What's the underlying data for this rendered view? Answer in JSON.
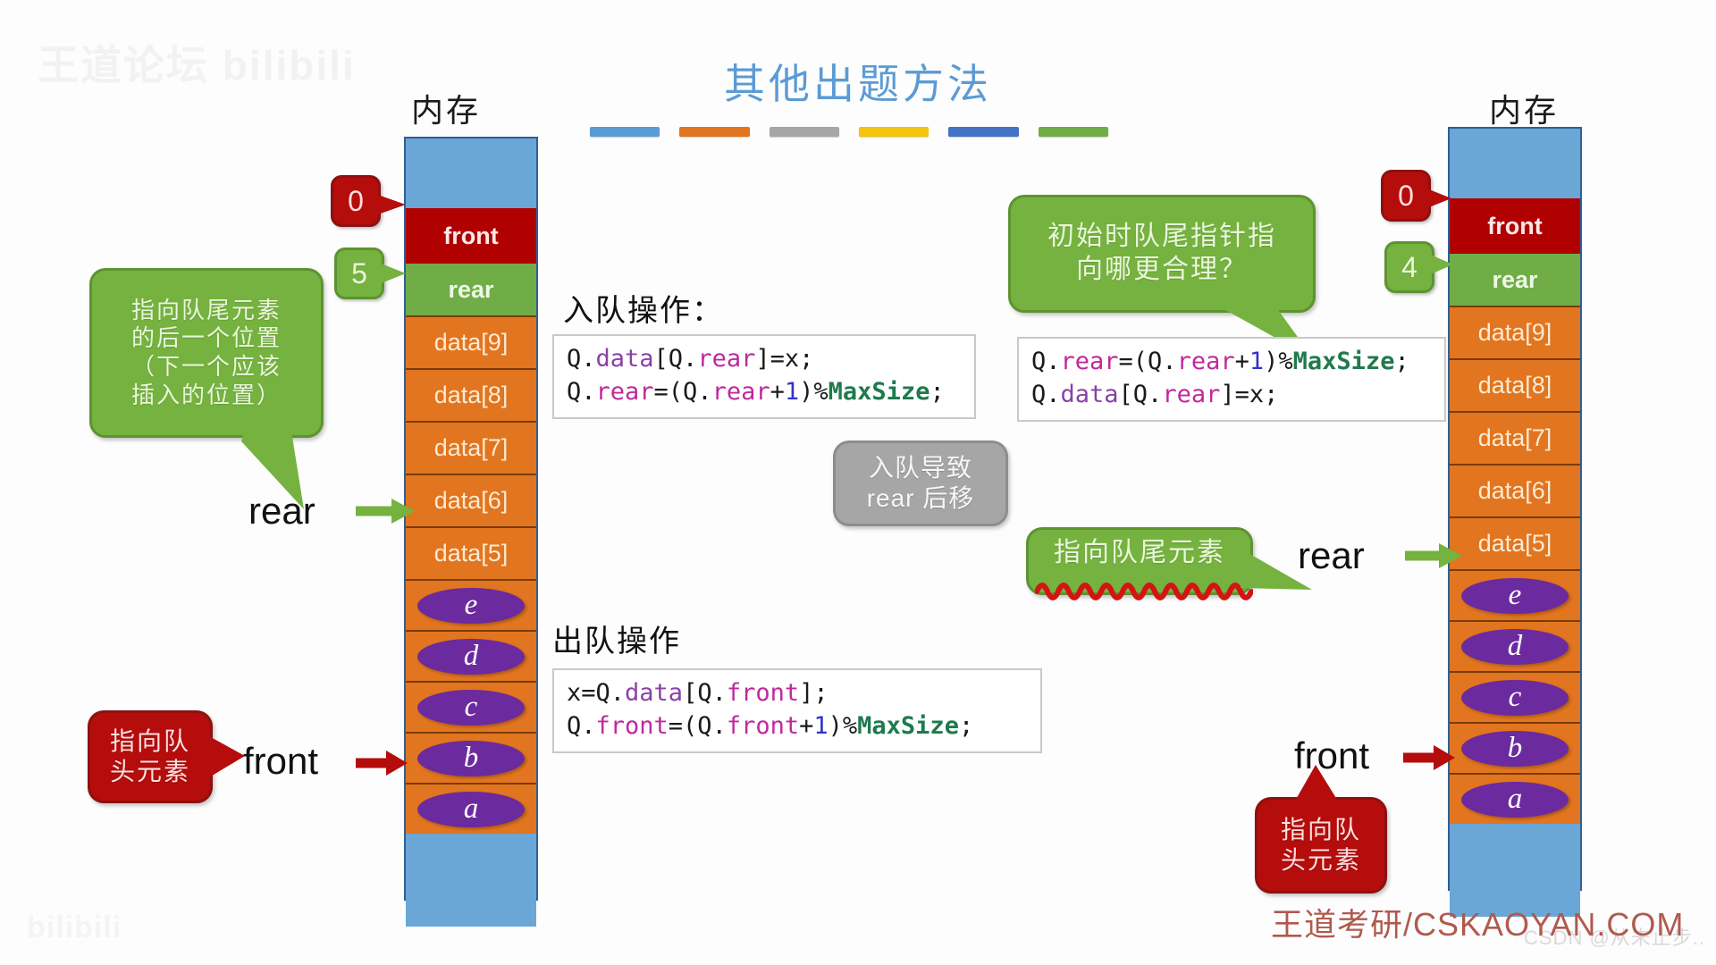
{
  "slide": {
    "title": "其他出题方法",
    "brand": "王道考研/CSKAOYAN.COM",
    "watermark_top": "王道论坛 bilibili",
    "watermark_bottom": "bilibili",
    "watermark_csdn": "CSDN @从未止步..",
    "accent_colors": [
      "#5b9bd5",
      "#e2751f",
      "#a6a6a6",
      "#f2c40c",
      "#4472c4",
      "#70ad47"
    ]
  },
  "left_diagram": {
    "memory_label": "内存",
    "badge_front": "0",
    "badge_rear": "5",
    "cells": [
      {
        "type": "blank",
        "text": ""
      },
      {
        "type": "front",
        "text": "front"
      },
      {
        "type": "rear",
        "text": "rear"
      },
      {
        "type": "data",
        "text": "data[9]"
      },
      {
        "type": "data",
        "text": "data[8]"
      },
      {
        "type": "data",
        "text": "data[7]"
      },
      {
        "type": "data",
        "text": "data[6]"
      },
      {
        "type": "data",
        "text": "data[5]"
      },
      {
        "type": "elem",
        "text": "e"
      },
      {
        "type": "elem",
        "text": "d"
      },
      {
        "type": "elem",
        "text": "c"
      },
      {
        "type": "elem",
        "text": "b"
      },
      {
        "type": "elem",
        "text": "a"
      },
      {
        "type": "blank",
        "text": ""
      }
    ],
    "rear_pointer_label": "rear",
    "front_pointer_label": "front",
    "rear_bubble": "指向队尾元素\n的后一个位置\n（下一个应该\n插入的位置）",
    "front_bubble": "指向队\n头元素"
  },
  "right_diagram": {
    "memory_label": "内存",
    "badge_front": "0",
    "badge_rear": "4",
    "cells": [
      {
        "type": "blank",
        "text": ""
      },
      {
        "type": "front",
        "text": "front"
      },
      {
        "type": "rear",
        "text": "rear"
      },
      {
        "type": "data",
        "text": "data[9]"
      },
      {
        "type": "data",
        "text": "data[8]"
      },
      {
        "type": "data",
        "text": "data[7]"
      },
      {
        "type": "data",
        "text": "data[6]"
      },
      {
        "type": "data",
        "text": "data[5]"
      },
      {
        "type": "elem",
        "text": "e"
      },
      {
        "type": "elem",
        "text": "d"
      },
      {
        "type": "elem",
        "text": "c"
      },
      {
        "type": "elem",
        "text": "b"
      },
      {
        "type": "elem",
        "text": "a"
      },
      {
        "type": "blank",
        "text": ""
      }
    ],
    "rear_pointer_label": "rear",
    "front_pointer_label": "front",
    "rear_bubble": "指向队尾元素",
    "front_bubble": "指向队\n头元素",
    "question_bubble": "初始时队尾指针指\n向哪更合理？"
  },
  "notes": {
    "gray_bubble": "入队导致\nrear 后移"
  },
  "code": {
    "enqueue_label": "入队操作：",
    "dequeue_label": "出队操作",
    "enqueue_left": {
      "line1": {
        "p1": "Q.",
        "attr": "data",
        "p2": "[Q.",
        "prop": "rear",
        "p3": "]=x;"
      },
      "line2": {
        "p1": "Q.",
        "prop1": "rear",
        "p2": "=(Q.",
        "prop2": "rear",
        "p3": "+",
        "num": "1",
        "p4": ")%",
        "const": "MaxSize",
        "p5": ";"
      }
    },
    "enqueue_right": {
      "line1": {
        "p1": "Q.",
        "prop1": "rear",
        "p2": "=(Q.",
        "prop2": "rear",
        "p3": "+",
        "num": "1",
        "p4": ")%",
        "const": "MaxSize",
        "p5": ";"
      },
      "line2": {
        "p1": "Q.",
        "attr": "data",
        "p2": "[Q.",
        "prop": "rear",
        "p3": "]=x;"
      }
    },
    "dequeue": {
      "line1": {
        "p0": "x=Q.",
        "attr": "data",
        "p2": "[Q.",
        "prop": "front",
        "p3": "];"
      },
      "line2": {
        "p1": "Q.",
        "prop1": "front",
        "p2": "=(Q.",
        "prop2": "front",
        "p3": "+",
        "num": "1",
        "p4": ")%",
        "const": "MaxSize",
        "p5": ";"
      }
    }
  }
}
